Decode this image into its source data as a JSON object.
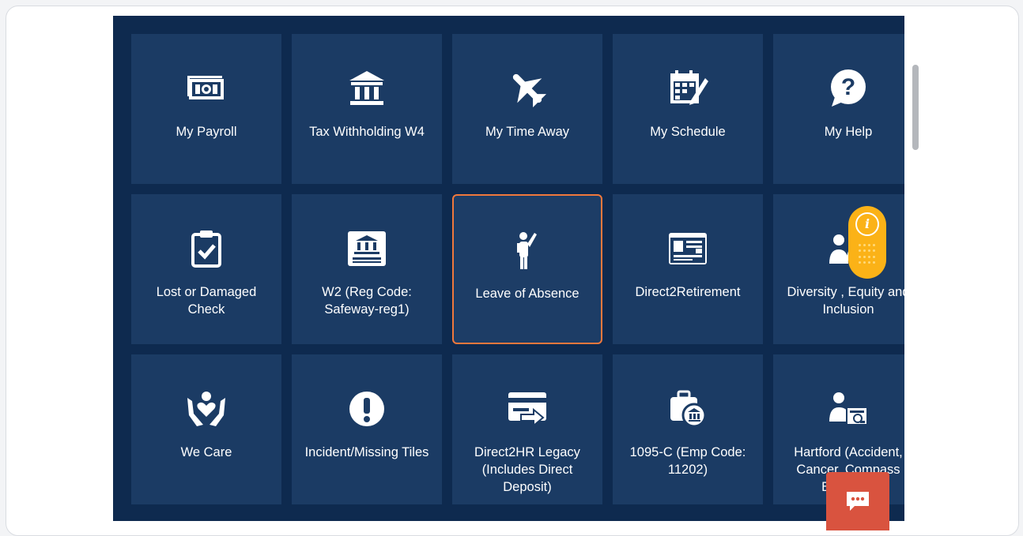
{
  "tiles": [
    {
      "label": "My Payroll",
      "icon": "money-icon"
    },
    {
      "label": "Tax Withholding W4",
      "icon": "bank-icon"
    },
    {
      "label": "My Time Away",
      "icon": "airplane-icon"
    },
    {
      "label": "My Schedule",
      "icon": "calendar-edit-icon"
    },
    {
      "label": "My Help",
      "icon": "question-bubble-icon"
    },
    {
      "label": "Lost or Damaged Check",
      "icon": "clipboard-check-icon"
    },
    {
      "label": "W2 (Reg Code: Safeway-reg1)",
      "icon": "bank-form-icon"
    },
    {
      "label": "Leave of Absence",
      "icon": "person-waving-icon"
    },
    {
      "label": "Direct2Retirement",
      "icon": "browser-card-icon"
    },
    {
      "label": "Diversity , Equity and Inclusion",
      "icon": "people-icon"
    },
    {
      "label": "We Care",
      "icon": "hands-heart-icon"
    },
    {
      "label": "Incident/Missing Tiles",
      "icon": "exclamation-circle-icon"
    },
    {
      "label": "Direct2HR Legacy (Includes Direct Deposit)",
      "icon": "card-arrow-icon"
    },
    {
      "label": "1095-C (Emp Code: 11202)",
      "icon": "briefcase-bank-icon"
    },
    {
      "label": "Hartford (Accident, Cancer, Compass Benefit…",
      "icon": "person-document-icon"
    }
  ],
  "highlight_color": "#f0783c",
  "panel_color": "#0e2a4f",
  "tile_color": "#1b3b64",
  "info_widget": {
    "icon": "info-icon",
    "color": "#fbb217"
  },
  "chat_button": {
    "icon": "chat-icon",
    "color": "#d9533f"
  }
}
